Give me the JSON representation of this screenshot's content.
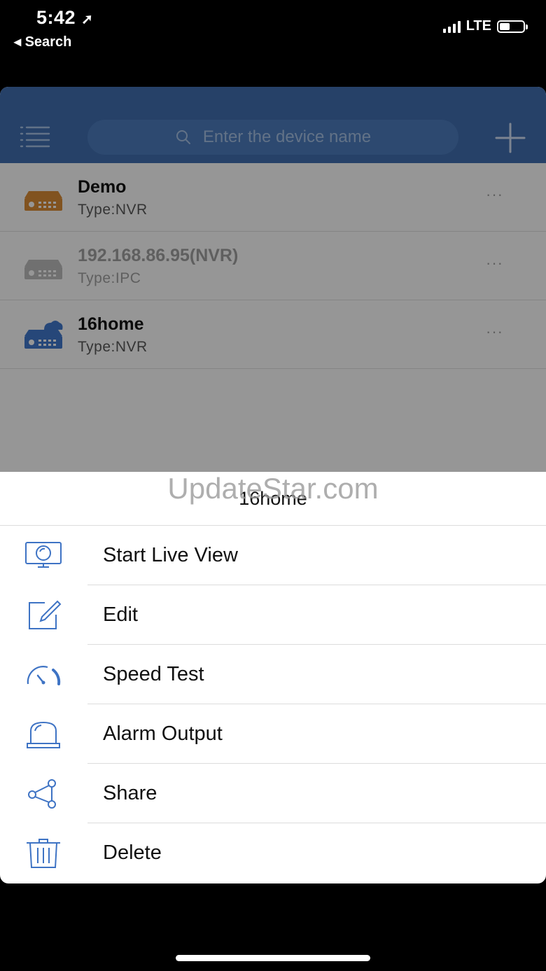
{
  "status_bar": {
    "time": "5:42",
    "location_arrow": "➚",
    "back_label": "◂ Search",
    "network": "LTE",
    "battery_level": 0.45
  },
  "header": {
    "search_placeholder": "Enter the device name",
    "accent_color": "#3e6aa8"
  },
  "devices": [
    {
      "name": "Demo",
      "type": "Type:NVR",
      "more": "···",
      "icon": "nvr-orange-icon"
    },
    {
      "name": "192.168.86.95(NVR)",
      "type": "Type:IPC",
      "more": "···",
      "icon": "nvr-gray-icon"
    },
    {
      "name": "16home",
      "type": "Type:NVR",
      "more": "···",
      "icon": "nvr-cloud-icon"
    }
  ],
  "sheet": {
    "title": "16home",
    "watermark": "UpdateStar.com",
    "items": [
      {
        "label": "Start Live View",
        "icon": "monitor-icon"
      },
      {
        "label": "Edit",
        "icon": "edit-icon"
      },
      {
        "label": "Speed Test",
        "icon": "speedometer-icon"
      },
      {
        "label": "Alarm Output",
        "icon": "alarm-icon"
      },
      {
        "label": "Share",
        "icon": "share-icon"
      },
      {
        "label": "Delete",
        "icon": "trash-icon"
      }
    ]
  }
}
